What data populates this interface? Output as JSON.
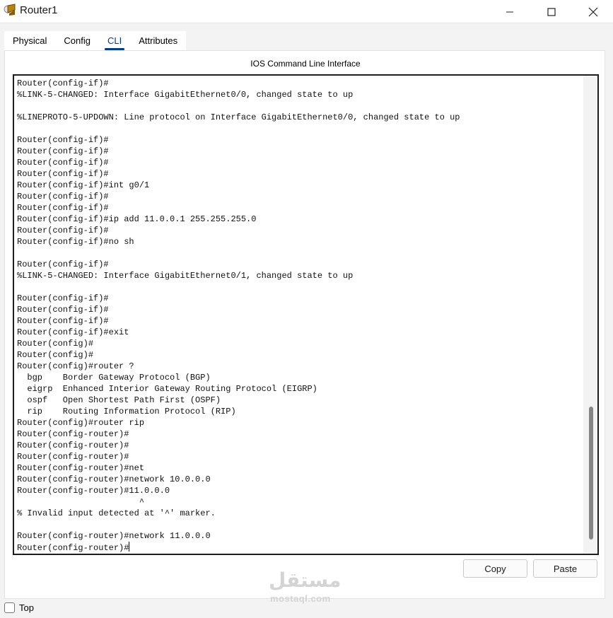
{
  "window": {
    "title": "Router1",
    "icon": "router-app-icon"
  },
  "tabs": [
    {
      "label": "Physical",
      "active": false
    },
    {
      "label": "Config",
      "active": false
    },
    {
      "label": "CLI",
      "active": true
    },
    {
      "label": "Attributes",
      "active": false
    }
  ],
  "panel": {
    "title": "IOS Command Line Interface"
  },
  "terminal": {
    "text": "Router(config-if)#\n%LINK-5-CHANGED: Interface GigabitEthernet0/0, changed state to up\n\n%LINEPROTO-5-UPDOWN: Line protocol on Interface GigabitEthernet0/0, changed state to up\n\nRouter(config-if)#\nRouter(config-if)#\nRouter(config-if)#\nRouter(config-if)#\nRouter(config-if)#int g0/1\nRouter(config-if)#\nRouter(config-if)#\nRouter(config-if)#ip add 11.0.0.1 255.255.255.0\nRouter(config-if)#\nRouter(config-if)#no sh\n\nRouter(config-if)#\n%LINK-5-CHANGED: Interface GigabitEthernet0/1, changed state to up\n\nRouter(config-if)#\nRouter(config-if)#\nRouter(config-if)#\nRouter(config-if)#exit\nRouter(config)#\nRouter(config)#\nRouter(config)#router ?\n  bgp    Border Gateway Protocol (BGP)\n  eigrp  Enhanced Interior Gateway Routing Protocol (EIGRP)\n  ospf   Open Shortest Path First (OSPF)\n  rip    Routing Information Protocol (RIP)\nRouter(config)#router rip\nRouter(config-router)#\nRouter(config-router)#\nRouter(config-router)#\nRouter(config-router)#net\nRouter(config-router)#network 10.0.0.0\nRouter(config-router)#11.0.0.0\n                        ^\n% Invalid input detected at '^' marker.\n\nRouter(config-router)#network 11.0.0.0\nRouter(config-router)#"
  },
  "buttons": {
    "copy": "Copy",
    "paste": "Paste"
  },
  "watermark": {
    "arabic": "مستقل",
    "latin": "mostaql.com"
  },
  "footer": {
    "top_label": "Top",
    "top_checked": false
  }
}
